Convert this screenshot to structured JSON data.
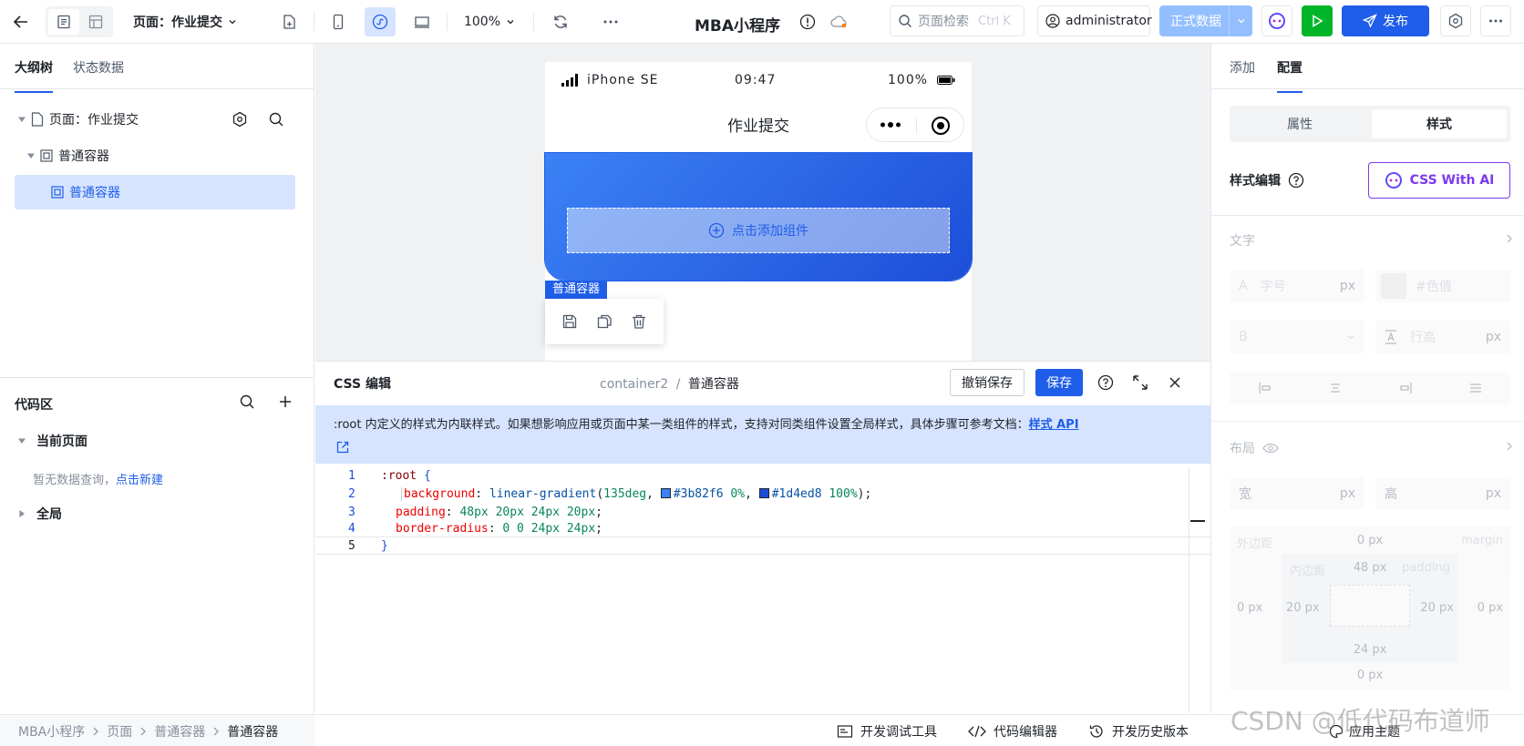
{
  "topbar": {
    "page_selector": "页面：作业提交",
    "zoom": "100%",
    "app_title": "MBA小程序",
    "search_placeholder": "页面检索",
    "search_shortcut": "Ctrl K",
    "user": "administrator",
    "env": "正式数据",
    "publish": "发布"
  },
  "left": {
    "tabs": [
      "大纲树",
      "状态数据"
    ],
    "tree": {
      "page": "页面：作业提交",
      "container1": "普通容器",
      "container2": "普通容器"
    },
    "code_area": {
      "title": "代码区",
      "current_page": "当前页面",
      "empty_prefix": "暂无数据查询，",
      "empty_link": "点击新建",
      "global": "全局"
    }
  },
  "phone": {
    "device": "iPhone SE",
    "time": "09:47",
    "battery": "100%",
    "nav_title": "作业提交",
    "add_component": "点击添加组件",
    "selected_tag": "普通容器"
  },
  "editor": {
    "title": "CSS 编辑",
    "path_id": "container2",
    "path_sep": "/",
    "path_name": "普通容器",
    "revert": "撤销保存",
    "save": "保存",
    "info_text": ":root 内定义的样式为内联样式。如果想影响应用或页面中某一类组件的样式，支持对同类组件设置全局样式，具体步骤可参考文档：",
    "info_link": "样式 API",
    "code_lines": [
      {
        "num": "1",
        "sel": ":root",
        "brace": "{"
      },
      {
        "num": "2",
        "prop": "background",
        "fn": "linear-gradient",
        "arg1": "135deg",
        "c1": "#3b82f6",
        "p1": "0%",
        "c2": "#1d4ed8",
        "p2": "100%"
      },
      {
        "num": "3",
        "prop": "padding",
        "val": "48px 20px 24px 20px"
      },
      {
        "num": "4",
        "prop": "border-radius",
        "val": "0 0 24px 24px"
      },
      {
        "num": "5",
        "brace": "}"
      }
    ]
  },
  "right": {
    "tabs": [
      "添加",
      "配置"
    ],
    "seg": [
      "属性",
      "样式"
    ],
    "style_edit": "样式编辑",
    "css_ai": "CSS With AI",
    "text_section": "文字",
    "font_size_ph": "字号",
    "unit_px": "px",
    "color_ph": "#色值",
    "bold_label": "B",
    "line_height_ph": "行高",
    "layout_section": "布局",
    "width_label": "宽",
    "height_label": "高",
    "margin_cn": "外边距",
    "margin_en": "margin",
    "padding_cn": "内边距",
    "padding_en": "padding",
    "margin_top": "0 px",
    "margin_left": "0 px",
    "margin_right": "0 px",
    "margin_bottom": "0 px",
    "padding_top": "48 px",
    "padding_left": "20 px",
    "padding_right": "20 px",
    "padding_bottom": "24 px",
    "theme": "应用主题"
  },
  "status": {
    "breadcrumb": [
      "MBA小程序",
      "页面",
      "普通容器",
      "普通容器"
    ],
    "dev_tools": "开发调试工具",
    "code_editor": "代码编辑器",
    "history": "开发历史版本"
  },
  "watermark": "CSDN @低代码布道师",
  "colors": {
    "primary": "#1f5ee8",
    "gradient_start": "#3b82f6",
    "gradient_end": "#1d4ed8",
    "info_bg": "#d6e4ff",
    "green": "#00b42a",
    "selected_bg": "#d6e4ff"
  }
}
